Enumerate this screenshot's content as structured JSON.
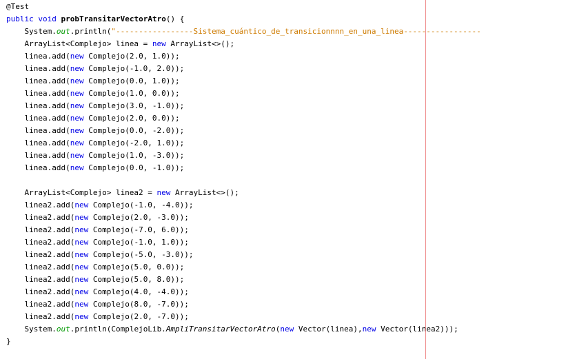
{
  "editor": {
    "lines": [
      [
        {
          "t": "@Test",
          "c": "annotation"
        }
      ],
      [
        {
          "t": "public",
          "c": "keyword"
        },
        {
          "t": " "
        },
        {
          "t": "void",
          "c": "keyword"
        },
        {
          "t": " "
        },
        {
          "t": "probTransitarVectorAtro",
          "c": "bold"
        },
        {
          "t": "() {"
        }
      ],
      [
        {
          "t": "    System."
        },
        {
          "t": "out",
          "c": "field"
        },
        {
          "t": ".println("
        },
        {
          "t": "\"-----------------Sistema_cuántico_de_transicionnnn_en_una_linea-----------------",
          "c": "string"
        }
      ],
      [
        {
          "t": "    ArrayList<Complejo> linea = "
        },
        {
          "t": "new",
          "c": "keyword"
        },
        {
          "t": " ArrayList<>();"
        }
      ],
      [
        {
          "t": "    linea.add("
        },
        {
          "t": "new",
          "c": "keyword"
        },
        {
          "t": " Complejo(2.0, 1.0));"
        }
      ],
      [
        {
          "t": "    linea.add("
        },
        {
          "t": "new",
          "c": "keyword"
        },
        {
          "t": " Complejo(-1.0, 2.0));"
        }
      ],
      [
        {
          "t": "    linea.add("
        },
        {
          "t": "new",
          "c": "keyword"
        },
        {
          "t": " Complejo(0.0, 1.0));"
        }
      ],
      [
        {
          "t": "    linea.add("
        },
        {
          "t": "new",
          "c": "keyword"
        },
        {
          "t": " Complejo(1.0, 0.0));"
        }
      ],
      [
        {
          "t": "    linea.add("
        },
        {
          "t": "new",
          "c": "keyword"
        },
        {
          "t": " Complejo(3.0, -1.0));"
        }
      ],
      [
        {
          "t": "    linea.add("
        },
        {
          "t": "new",
          "c": "keyword"
        },
        {
          "t": " Complejo(2.0, 0.0));"
        }
      ],
      [
        {
          "t": "    linea.add("
        },
        {
          "t": "new",
          "c": "keyword"
        },
        {
          "t": " Complejo(0.0, -2.0));"
        }
      ],
      [
        {
          "t": "    linea.add("
        },
        {
          "t": "new",
          "c": "keyword"
        },
        {
          "t": " Complejo(-2.0, 1.0));"
        }
      ],
      [
        {
          "t": "    linea.add("
        },
        {
          "t": "new",
          "c": "keyword"
        },
        {
          "t": " Complejo(1.0, -3.0));"
        }
      ],
      [
        {
          "t": "    linea.add("
        },
        {
          "t": "new",
          "c": "keyword"
        },
        {
          "t": " Complejo(0.0, -1.0));"
        }
      ],
      [],
      [
        {
          "t": "    ArrayList<Complejo> linea2 = "
        },
        {
          "t": "new",
          "c": "keyword"
        },
        {
          "t": " ArrayList<>();"
        }
      ],
      [
        {
          "t": "    linea2.add("
        },
        {
          "t": "new",
          "c": "keyword"
        },
        {
          "t": " Complejo(-1.0, -4.0));"
        }
      ],
      [
        {
          "t": "    linea2.add("
        },
        {
          "t": "new",
          "c": "keyword"
        },
        {
          "t": " Complejo(2.0, -3.0));"
        }
      ],
      [
        {
          "t": "    linea2.add("
        },
        {
          "t": "new",
          "c": "keyword"
        },
        {
          "t": " Complejo(-7.0, 6.0));"
        }
      ],
      [
        {
          "t": "    linea2.add("
        },
        {
          "t": "new",
          "c": "keyword"
        },
        {
          "t": " Complejo(-1.0, 1.0));"
        }
      ],
      [
        {
          "t": "    linea2.add("
        },
        {
          "t": "new",
          "c": "keyword"
        },
        {
          "t": " Complejo(-5.0, -3.0));"
        }
      ],
      [
        {
          "t": "    linea2.add("
        },
        {
          "t": "new",
          "c": "keyword"
        },
        {
          "t": " Complejo(5.0, 0.0));"
        }
      ],
      [
        {
          "t": "    linea2.add("
        },
        {
          "t": "new",
          "c": "keyword"
        },
        {
          "t": " Complejo(5.0, 8.0));"
        }
      ],
      [
        {
          "t": "    linea2.add("
        },
        {
          "t": "new",
          "c": "keyword"
        },
        {
          "t": " Complejo(4.0, -4.0));"
        }
      ],
      [
        {
          "t": "    linea2.add("
        },
        {
          "t": "new",
          "c": "keyword"
        },
        {
          "t": " Complejo(8.0, -7.0));"
        }
      ],
      [
        {
          "t": "    linea2.add("
        },
        {
          "t": "new",
          "c": "keyword"
        },
        {
          "t": " Complejo(2.0, -7.0));"
        }
      ],
      [
        {
          "t": "    System."
        },
        {
          "t": "out",
          "c": "field"
        },
        {
          "t": ".println(ComplejoLib."
        },
        {
          "t": "AmpliTransitarVectorAtro",
          "c": "static-call"
        },
        {
          "t": "("
        },
        {
          "t": "new",
          "c": "keyword"
        },
        {
          "t": " Vector(linea),"
        },
        {
          "t": "new",
          "c": "keyword"
        },
        {
          "t": " Vector(linea2)));"
        }
      ],
      [
        {
          "t": "}"
        }
      ]
    ]
  }
}
